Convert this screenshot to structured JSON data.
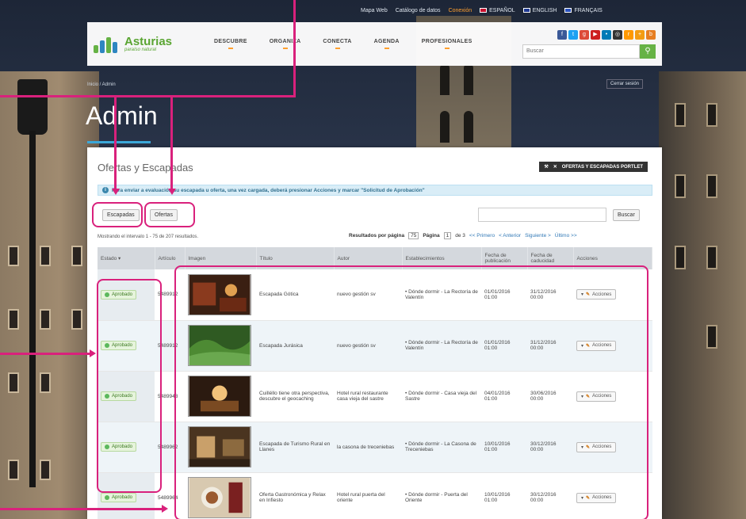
{
  "colors": {
    "accent": "#66b245",
    "annotation": "#d9217c",
    "brand_blue": "#3ba7d8",
    "connect": "#ff9f2f"
  },
  "topbar": {
    "items": [
      "Mapa Web",
      "Catálogo de datos",
      "Conexión"
    ],
    "languages": [
      "ESPAÑOL",
      "ENGLISH",
      "FRANÇAIS"
    ]
  },
  "header": {
    "logo_title": "Asturias",
    "logo_subtitle": "paraíso natural",
    "nav": [
      "DESCUBRE",
      "ORGANIZA",
      "CONECTA",
      "AGENDA",
      "PROFESIONALES"
    ],
    "search_placeholder": "Buscar",
    "search_icon": "search-icon"
  },
  "breadcrumb": "Inicio / Admin",
  "access_link": "Cerrar sesión",
  "page_title": "Admin",
  "panel": {
    "heading": "Ofertas y Escapadas",
    "tools_label": "OFERTAS Y ESCAPADAS PORTLET",
    "info_text": "Para enviar a evaluación su escapada u oferta, una vez cargada, deberá presionar Acciones y marcar \"Solicitud de Aprobación\"",
    "tab_escapadas": "Escapadas",
    "tab_ofertas": "Ofertas",
    "filter_button": "Buscar",
    "result_info": "Mostrando el intervalo 1 - 75 de 207 resultados.",
    "pager": {
      "per_page_label": "Resultados por página",
      "per_page_value": "75",
      "page_label": "Página",
      "page_value": "1",
      "page_of": "de 3",
      "first": "<< Primero",
      "prev": "< Anterior",
      "next": "Siguiente >",
      "last": "Último >>"
    }
  },
  "table": {
    "headers": [
      "Estado",
      "Artículo",
      "Imagen",
      "Título",
      "Autor",
      "Establecimientos",
      "Fecha de publicación",
      "Fecha de caducidad",
      "Acciones"
    ],
    "rows": [
      {
        "estado": "Aprobado",
        "articulo": "5489912",
        "imagen": "img-1",
        "titulo": "Escapada Gótica",
        "autor": "nuevo gestión sv",
        "establecimiento": "• Dónde dormir - La Rectoría de Valentín",
        "publicacion": "01/01/2016 01:00",
        "caducidad": "31/12/2016 00:00",
        "accion": "Acciones"
      },
      {
        "estado": "Aprobado",
        "articulo": "5489912",
        "imagen": "img-2",
        "titulo": "Escapada Jurásica",
        "autor": "nuevo gestión sv",
        "establecimiento": "• Dónde dormir - La Rectoría de Valentín",
        "publicacion": "01/01/2016 01:00",
        "caducidad": "31/12/2016 00:00",
        "accion": "Acciones"
      },
      {
        "estado": "Aprobado",
        "articulo": "5489948",
        "imagen": "img-3",
        "titulo": "Cuilléllo tiene otra perspectiva, descubre el geocaching",
        "autor": "Hotel rural restaurante casa vieja del sastre",
        "establecimiento": "• Dónde dormir - Casa vieja del Sastre",
        "publicacion": "04/01/2016 01:00",
        "caducidad": "30/06/2016 00:00",
        "accion": "Acciones"
      },
      {
        "estado": "Aprobado",
        "articulo": "5489962",
        "imagen": "img-4",
        "titulo": "Escapada de Turismo Rural en Llanes",
        "autor": "la casona de treceniebas",
        "establecimiento": "• Dónde dormir - La Casona de Treceniebas",
        "publicacion": "10/01/2016 01:00",
        "caducidad": "30/12/2016 00:00",
        "accion": "Acciones"
      },
      {
        "estado": "Aprobado",
        "articulo": "5489964",
        "imagen": "img-5",
        "titulo": "Oferta Gastronómica y Relax en Infiesto",
        "autor": "Hotel rural puerta del oriente",
        "establecimiento": "• Dónde dormir - Puerta del Oriente",
        "publicacion": "10/01/2016 01:00",
        "caducidad": "30/12/2016 00:00",
        "accion": "Acciones"
      }
    ]
  }
}
